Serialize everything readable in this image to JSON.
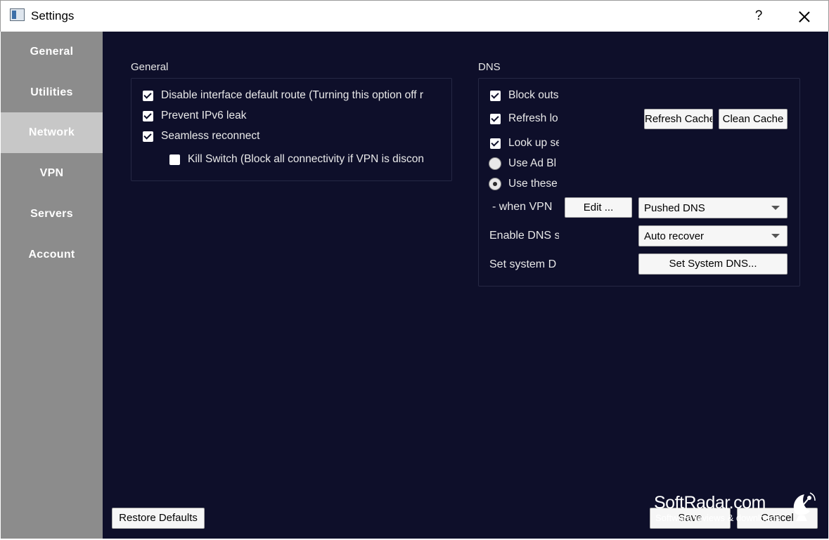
{
  "window": {
    "title": "Settings",
    "help_label": "?"
  },
  "sidebar": {
    "items": [
      {
        "label": "General"
      },
      {
        "label": "Utilities"
      },
      {
        "label": "Network",
        "active": true
      },
      {
        "label": "VPN"
      },
      {
        "label": "Servers"
      },
      {
        "label": "Account"
      }
    ]
  },
  "general": {
    "title": "General",
    "options": [
      {
        "label": "Disable interface default route (Turning this option off r",
        "checked": true
      },
      {
        "label": "Prevent IPv6 leak",
        "checked": true
      },
      {
        "label": "Seamless reconnect",
        "checked": true
      },
      {
        "label": "Kill Switch (Block all connectivity if VPN is discon",
        "checked": false
      }
    ]
  },
  "dns": {
    "title": "DNS",
    "block_outside": {
      "label": "Block outs",
      "checked": true
    },
    "refresh_local": {
      "label": "Refresh lo",
      "checked": true
    },
    "refresh_cache_button": "Refresh Cache",
    "clean_cache_button": "Clean Cache",
    "look_up": {
      "label": "Look up se",
      "checked": true
    },
    "use_ad_block": {
      "label": "Use Ad Bl",
      "selected": false
    },
    "use_these": {
      "label": "Use these",
      "selected": true
    },
    "when_vpn_label": "- when VPN",
    "edit_button": "Edit ...",
    "pushed_dns_select": "Pushed DNS",
    "enable_dns_label": "Enable DNS s",
    "auto_recover_select": "Auto recover",
    "set_system_label": "Set system D",
    "set_system_dns_button": "Set System DNS..."
  },
  "footer": {
    "restore_defaults": "Restore Defaults",
    "save": "Save",
    "cancel": "Cancel"
  },
  "watermark": {
    "brand": "SoftRadar.com",
    "tagline": "Software reviews & downloads"
  }
}
